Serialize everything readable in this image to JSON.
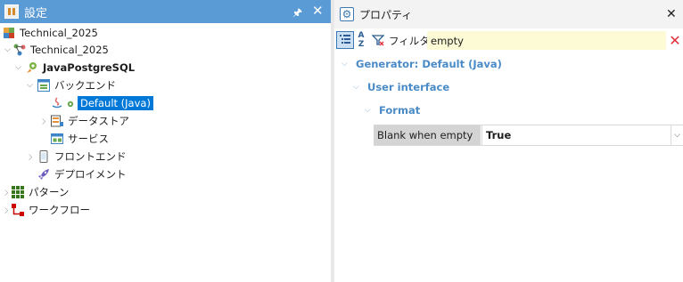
{
  "left_panel": {
    "title": "設定",
    "pin_glyph": "ᵖ",
    "close_glyph": "✕",
    "tree": {
      "root": {
        "label": "Technical_2025"
      },
      "model": {
        "label": "Technical_2025"
      },
      "generator": {
        "label": "JavaPostgreSQL"
      },
      "backend": {
        "label": "バックエンド"
      },
      "default_java": {
        "label": "Default (Java)"
      },
      "datastore": {
        "label": "データストア"
      },
      "services": {
        "label": "サービス"
      },
      "frontend": {
        "label": "フロントエンド"
      },
      "deployment": {
        "label": "デプロイメント"
      },
      "patterns": {
        "label": "パターン"
      },
      "workflow": {
        "label": "ワークフロー"
      }
    }
  },
  "right_panel": {
    "title": "プロパティ",
    "close_glyph": "✕",
    "toolbar": {
      "az_top": "A",
      "az_bottom": "Z",
      "filter_label": "フィルタ",
      "filter_value": "empty",
      "clear_glyph": "✕"
    },
    "groups": {
      "generator": "Generator: Default (Java)",
      "user_interface": "User interface",
      "format": "Format"
    },
    "property": {
      "name": "Blank when empty",
      "value": "True"
    }
  },
  "colors": {
    "title_bar": "#5b9bd5",
    "selection": "#0078d7",
    "category_text": "#4a8bc7",
    "filter_bg": "#fdfbd6",
    "clear_red": "#e0303a"
  }
}
